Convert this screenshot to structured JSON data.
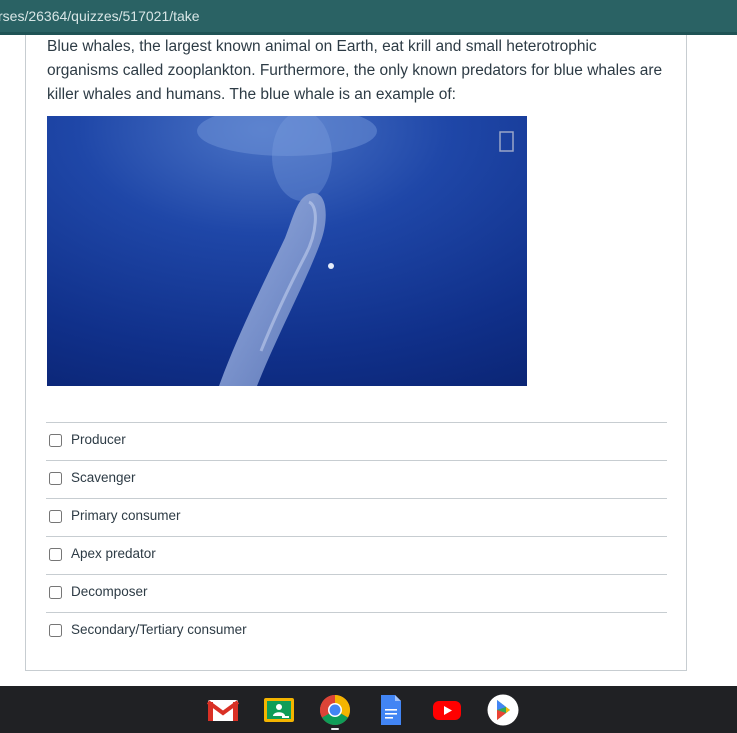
{
  "browser": {
    "url": "rses/26364/quizzes/517021/take"
  },
  "question": {
    "text": "Blue whales, the largest known animal on Earth, eat krill and small heterotrophic organisms called zooplankton. Furthermore, the only known predators for blue whales are killer whales and humans. The blue whale is an example of:"
  },
  "answers": [
    {
      "label": "Producer",
      "checked": false
    },
    {
      "label": "Scavenger",
      "checked": false
    },
    {
      "label": "Primary consumer",
      "checked": false
    },
    {
      "label": "Apex predator",
      "checked": false
    },
    {
      "label": "Decomposer",
      "checked": false
    },
    {
      "label": "Secondary/Tertiary consumer",
      "checked": false
    }
  ],
  "shelf": {
    "apps": [
      "gmail-icon",
      "google-classroom-icon",
      "chrome-icon",
      "google-docs-icon",
      "youtube-icon",
      "play-store-icon"
    ],
    "active_app": "chrome-icon"
  },
  "colors": {
    "url_bar": "#2a6264",
    "shelf": "#202124",
    "border": "#c7cdd1",
    "text": "#2d3b45"
  }
}
